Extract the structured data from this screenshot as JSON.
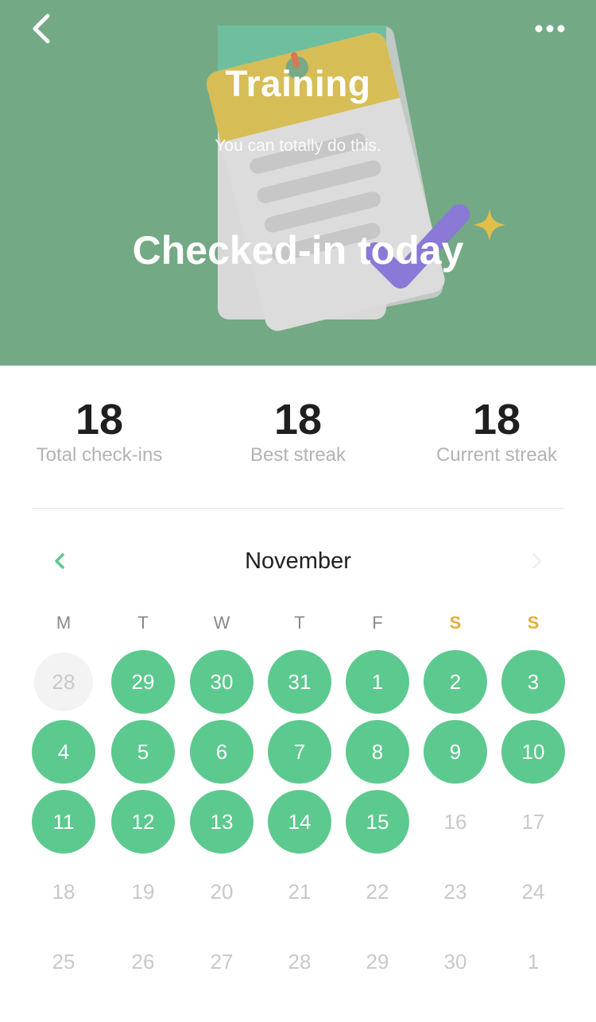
{
  "colors": {
    "hero_background": "#73a985",
    "checked_day": "#5cc98f",
    "weekend_label": "#e5ad3a",
    "accent": "#5cc98f"
  },
  "header": {
    "back_icon": "chevron-left-icon",
    "more_icon": "more-horizontal-icon"
  },
  "hero": {
    "title": "Training",
    "subtitle": "You can totally do this.",
    "status": "Checked-in today"
  },
  "stats": [
    {
      "value": "18",
      "label": "Total check-ins"
    },
    {
      "value": "18",
      "label": "Best streak"
    },
    {
      "value": "18",
      "label": "Current streak"
    }
  ],
  "calendar": {
    "month": "November",
    "prev_icon": "chevron-left-icon",
    "next_icon": "chevron-right-icon",
    "weekdays": [
      "M",
      "T",
      "W",
      "T",
      "F",
      "S",
      "S"
    ],
    "weeks": [
      [
        {
          "d": "28",
          "s": "outside"
        },
        {
          "d": "29",
          "s": "checked"
        },
        {
          "d": "30",
          "s": "checked"
        },
        {
          "d": "31",
          "s": "checked"
        },
        {
          "d": "1",
          "s": "checked"
        },
        {
          "d": "2",
          "s": "checked"
        },
        {
          "d": "3",
          "s": "checked"
        }
      ],
      [
        {
          "d": "4",
          "s": "checked"
        },
        {
          "d": "5",
          "s": "checked"
        },
        {
          "d": "6",
          "s": "checked"
        },
        {
          "d": "7",
          "s": "checked"
        },
        {
          "d": "8",
          "s": "checked"
        },
        {
          "d": "9",
          "s": "checked"
        },
        {
          "d": "10",
          "s": "checked"
        }
      ],
      [
        {
          "d": "11",
          "s": "checked"
        },
        {
          "d": "12",
          "s": "checked"
        },
        {
          "d": "13",
          "s": "checked"
        },
        {
          "d": "14",
          "s": "checked"
        },
        {
          "d": "15",
          "s": "checked"
        },
        {
          "d": "16",
          "s": "future"
        },
        {
          "d": "17",
          "s": "future"
        }
      ],
      [
        {
          "d": "18",
          "s": "future"
        },
        {
          "d": "19",
          "s": "future"
        },
        {
          "d": "20",
          "s": "future"
        },
        {
          "d": "21",
          "s": "future"
        },
        {
          "d": "22",
          "s": "future"
        },
        {
          "d": "23",
          "s": "future"
        },
        {
          "d": "24",
          "s": "future"
        }
      ],
      [
        {
          "d": "25",
          "s": "future"
        },
        {
          "d": "26",
          "s": "future"
        },
        {
          "d": "27",
          "s": "future"
        },
        {
          "d": "28",
          "s": "future"
        },
        {
          "d": "29",
          "s": "future"
        },
        {
          "d": "30",
          "s": "future"
        },
        {
          "d": "1",
          "s": "future"
        }
      ]
    ]
  }
}
